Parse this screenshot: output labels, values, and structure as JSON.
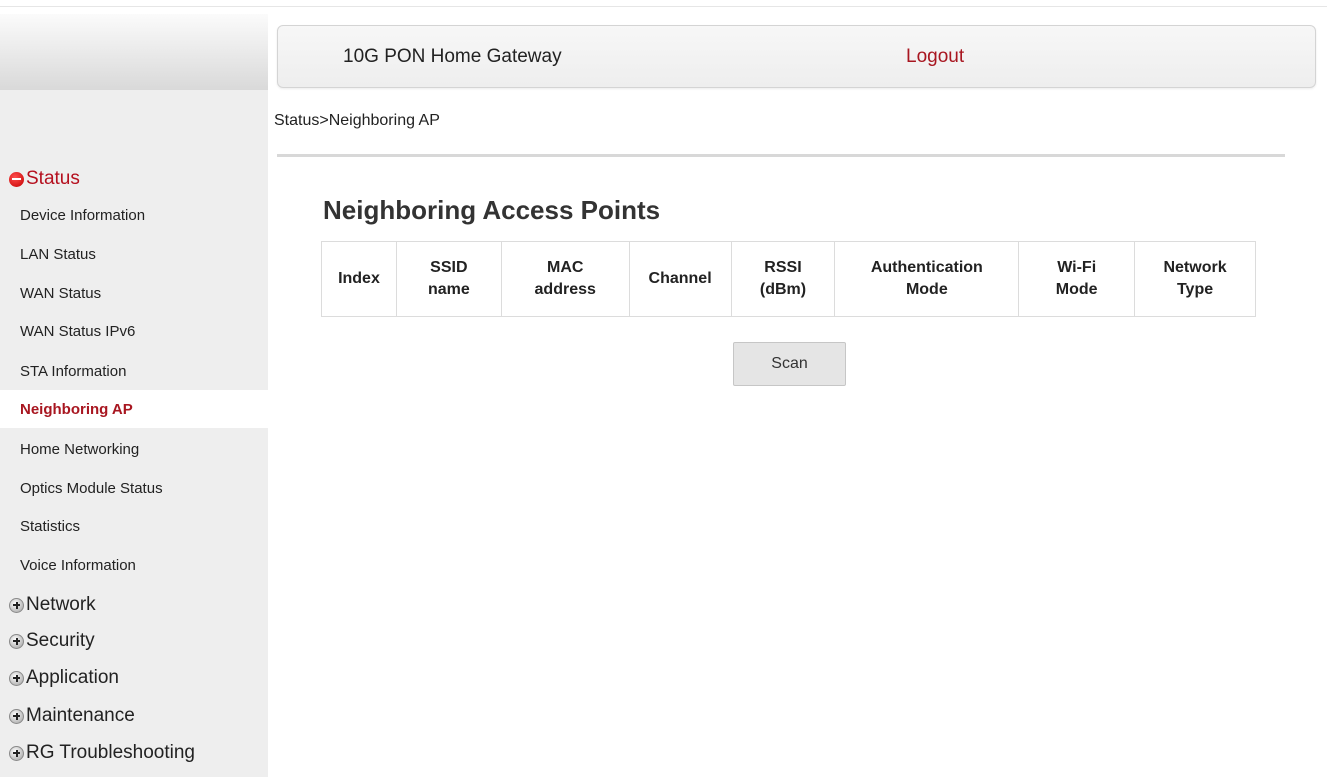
{
  "header": {
    "title": "10G PON Home Gateway",
    "logout_label": "Logout"
  },
  "breadcrumb": "Status>Neighboring AP",
  "sidebar": {
    "groups": [
      {
        "label": "Status",
        "expanded": true
      },
      {
        "label": "Network",
        "expanded": false
      },
      {
        "label": "Security",
        "expanded": false
      },
      {
        "label": "Application",
        "expanded": false
      },
      {
        "label": "Maintenance",
        "expanded": false
      },
      {
        "label": "RG Troubleshooting",
        "expanded": false
      }
    ],
    "status_items": [
      {
        "label": "Device Information"
      },
      {
        "label": "LAN Status"
      },
      {
        "label": "WAN Status"
      },
      {
        "label": "WAN Status IPv6"
      },
      {
        "label": "STA Information"
      },
      {
        "label": "Neighboring AP",
        "selected": true
      },
      {
        "label": "Home Networking"
      },
      {
        "label": "Optics Module Status"
      },
      {
        "label": "Statistics"
      },
      {
        "label": "Voice Information"
      }
    ]
  },
  "main": {
    "title": "Neighboring Access Points",
    "columns": [
      {
        "line1": "Index",
        "line2": ""
      },
      {
        "line1": "SSID",
        "line2": "name"
      },
      {
        "line1": "MAC",
        "line2": "address"
      },
      {
        "line1": "Channel",
        "line2": ""
      },
      {
        "line1": "RSSI",
        "line2": "(dBm)"
      },
      {
        "line1": "Authentication",
        "line2": "Mode"
      },
      {
        "line1": "Wi-Fi",
        "line2": "Mode"
      },
      {
        "line1": "Network",
        "line2": "Type"
      }
    ],
    "rows": [],
    "scan_label": "Scan"
  },
  "colors": {
    "accent": "#a81620",
    "sidebar_bg": "#eeeeee"
  }
}
